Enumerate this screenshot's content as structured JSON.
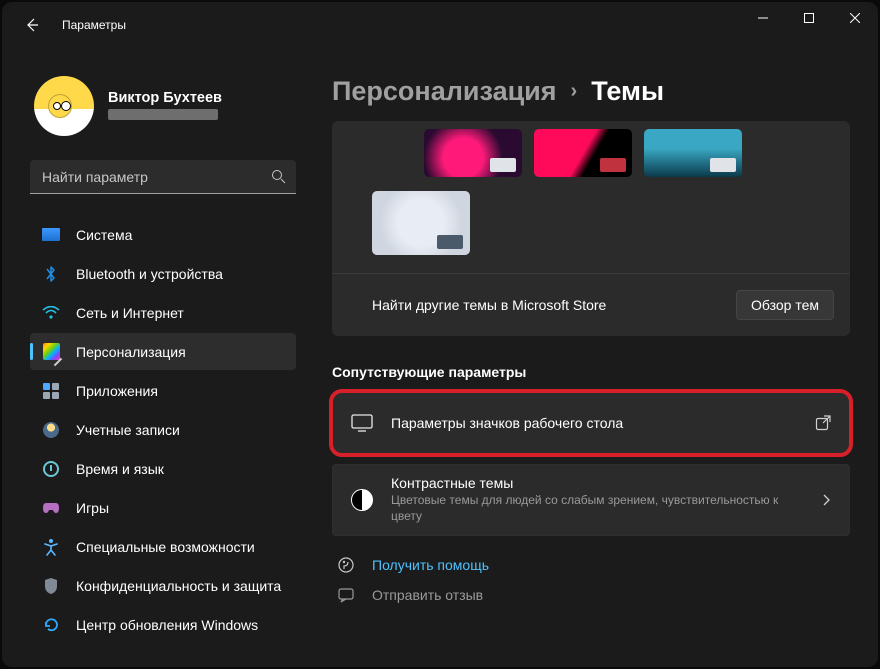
{
  "titlebar": {
    "title": "Параметры"
  },
  "profile": {
    "name": "Виктор Бухтеев"
  },
  "search": {
    "placeholder": "Найти параметр"
  },
  "nav": [
    {
      "label": "Система"
    },
    {
      "label": "Bluetooth и устройства"
    },
    {
      "label": "Сеть и Интернет"
    },
    {
      "label": "Персонализация"
    },
    {
      "label": "Приложения"
    },
    {
      "label": "Учетные записи"
    },
    {
      "label": "Время и язык"
    },
    {
      "label": "Игры"
    },
    {
      "label": "Специальные возможности"
    },
    {
      "label": "Конфиденциальность и защита"
    },
    {
      "label": "Центр обновления Windows"
    }
  ],
  "breadcrumb": {
    "parent": "Персонализация",
    "sep": "›",
    "current": "Темы"
  },
  "store": {
    "text": "Найти другие темы в Microsoft Store",
    "button": "Обзор тем"
  },
  "section": {
    "related": "Сопутствующие параметры"
  },
  "rows": {
    "desktop_icons": "Параметры значков рабочего стола",
    "contrast_title": "Контрастные темы",
    "contrast_sub": "Цветовые темы для людей со слабым зрением, чувствительностью к цвету"
  },
  "help": {
    "get_help": "Получить помощь",
    "feedback": "Отправить отзыв"
  }
}
